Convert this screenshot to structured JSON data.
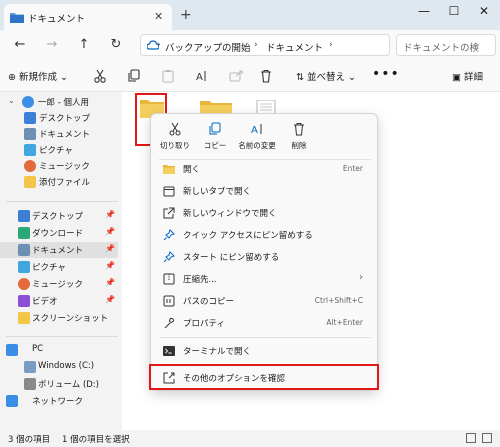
{
  "window": {
    "tab_title": "ドキュメント",
    "tab_close": "✕",
    "new_tab": "+",
    "minimize": "—",
    "maximize": "☐",
    "close": "✕"
  },
  "nav": {
    "back": "←",
    "forward": "→",
    "up": "↑",
    "refresh": "↻",
    "address_part1": "バックアップの開始",
    "address_part2": "ドキュメント",
    "chevron": "›",
    "search_placeholder": "ドキュメントの検"
  },
  "toolbar": {
    "new_label": "⊕ 新規作成 ⌄",
    "sort_label": "⇅ 並べ替え ⌄",
    "more_label": "•••",
    "details_label": "▣ 詳細"
  },
  "sidebar": {
    "items": [
      {
        "label": "一郎 - 個人用",
        "pinned": false
      },
      {
        "label": "デスクトップ",
        "pinned": false
      },
      {
        "label": "ドキュメント",
        "pinned": false
      },
      {
        "label": "ピクチャ",
        "pinned": false
      },
      {
        "label": "ミュージック",
        "pinned": false
      },
      {
        "label": "添付ファイル",
        "pinned": false
      },
      {
        "label": "デスクトップ",
        "pinned": true
      },
      {
        "label": "ダウンロード",
        "pinned": true
      },
      {
        "label": "ドキュメント",
        "pinned": true
      },
      {
        "label": "ピクチャ",
        "pinned": true
      },
      {
        "label": "ミュージック",
        "pinned": true
      },
      {
        "label": "ビデオ",
        "pinned": true
      },
      {
        "label": "スクリーンショット",
        "pinned": false
      },
      {
        "label": "PC",
        "pinned": false
      },
      {
        "label": "Windows (C:)",
        "pinned": false
      },
      {
        "label": "ボリューム (D:)",
        "pinned": false
      },
      {
        "label": "ネットワーク",
        "pinned": false
      }
    ],
    "pin_glyph": "📌"
  },
  "status": {
    "count": "3 個の項目",
    "selected": "1 個の項目を選択"
  },
  "context_menu": {
    "quick": {
      "cut": "切り取り",
      "copy": "コピー",
      "rename": "名前の変更",
      "delete": "削除"
    },
    "items": {
      "open": {
        "label": "開く",
        "shortcut": "Enter"
      },
      "open_new_tab": {
        "label": "新しいタブで開く"
      },
      "open_new_window": {
        "label": "新しいウィンドウで開く"
      },
      "pin_quick": {
        "label": "クイック アクセスにピン留めする"
      },
      "pin_start": {
        "label": "スタート にピン留めする"
      },
      "compress": {
        "label": "圧縮先...",
        "arrow": "›"
      },
      "copy_path": {
        "label": "パスのコピー",
        "shortcut": "Ctrl+Shift+C"
      },
      "properties": {
        "label": "プロパティ",
        "shortcut": "Alt+Enter"
      },
      "terminal": {
        "label": "ターミナルで開く"
      },
      "more_options": {
        "label": "その他のオプションを確認"
      }
    }
  },
  "colors": {
    "accent": "#0067c0",
    "folder": "#f3c64a",
    "highlight_box": "#e01818"
  }
}
